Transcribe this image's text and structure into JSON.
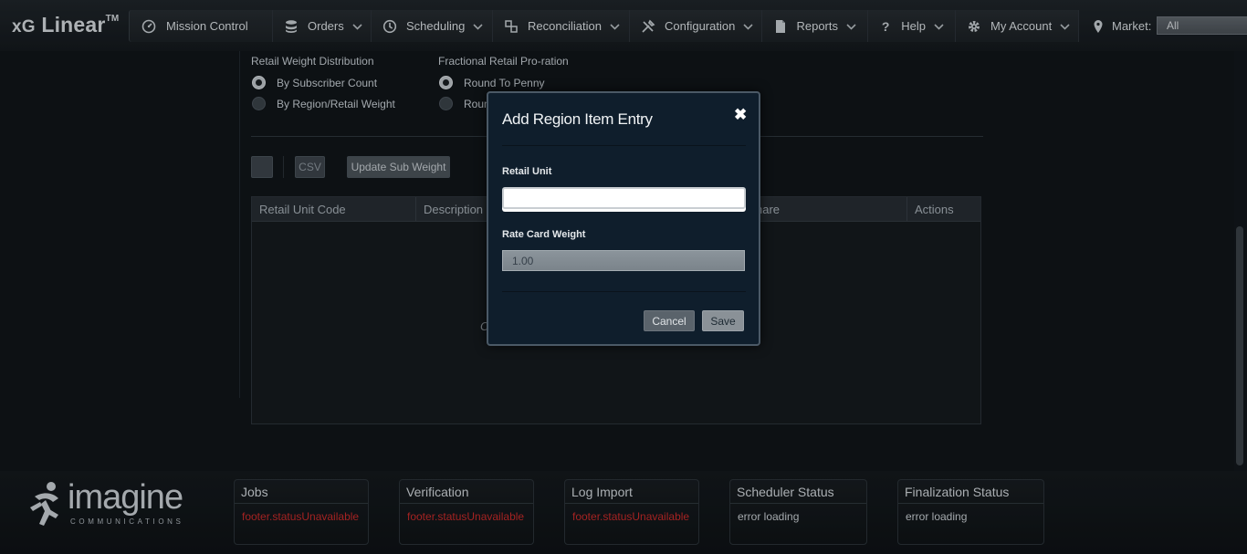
{
  "app": {
    "brand": "xG Linear",
    "brand_prefix": "xG",
    "brand_name": "Linear",
    "brand_tm": "TM"
  },
  "nav": {
    "items": [
      {
        "label": "Mission Control",
        "icon": "gauge-icon",
        "has_chevron": false
      },
      {
        "label": "Orders",
        "icon": "database-icon",
        "has_chevron": true
      },
      {
        "label": "Scheduling",
        "icon": "clock-icon",
        "has_chevron": true
      },
      {
        "label": "Reconciliation",
        "icon": "reconcile-icon",
        "has_chevron": true
      },
      {
        "label": "Configuration",
        "icon": "tools-icon",
        "has_chevron": true
      },
      {
        "label": "Reports",
        "icon": "document-icon",
        "has_chevron": true
      },
      {
        "label": "Help",
        "icon": "question-icon",
        "has_chevron": true
      },
      {
        "label": "My Account",
        "icon": "gear-icon",
        "has_chevron": true
      }
    ],
    "market_label": "Market:",
    "market_value": "All"
  },
  "settings": {
    "distribution_title": "Retail Weight Distribution",
    "distribution_options": [
      {
        "label": "By Subscriber Count",
        "checked": true
      },
      {
        "label": "By Region/Retail Weight",
        "checked": false
      }
    ],
    "proration_title": "Fractional Retail Pro-ration",
    "proration_options": [
      {
        "label": "Round To Penny",
        "checked": true
      },
      {
        "label": "Roun",
        "checked": false
      }
    ]
  },
  "toolbar": {
    "csv_label": "CSV",
    "update_label": "Update Sub Weight"
  },
  "grid": {
    "columns": [
      "Retail Unit Code",
      "Description",
      "",
      "hare",
      "Actions"
    ],
    "empty_text": "C"
  },
  "modal": {
    "title": "Add Region Item Entry",
    "close": "✖",
    "retail_unit_label": "Retail Unit",
    "retail_unit_value": "",
    "rate_card_label": "Rate Card Weight",
    "rate_card_value": "1.00",
    "cancel_label": "Cancel",
    "save_label": "Save"
  },
  "footer": {
    "logo_word": "imagine",
    "logo_sub": "COMMUNICATIONS",
    "boxes": [
      {
        "title": "Jobs",
        "value": "footer.statusUnavailable",
        "kind": "err"
      },
      {
        "title": "Verification",
        "value": "footer.statusUnavailable",
        "kind": "err"
      },
      {
        "title": "Log Import",
        "value": "footer.statusUnavailable",
        "kind": "err"
      },
      {
        "title": "Scheduler Status",
        "value": "error loading",
        "kind": "plain"
      },
      {
        "title": "Finalization Status",
        "value": "error loading",
        "kind": "plain"
      }
    ]
  },
  "colors": {
    "background": "#101519",
    "modal_bg": "#0f1e2c",
    "error_text": "#c92a2a"
  }
}
